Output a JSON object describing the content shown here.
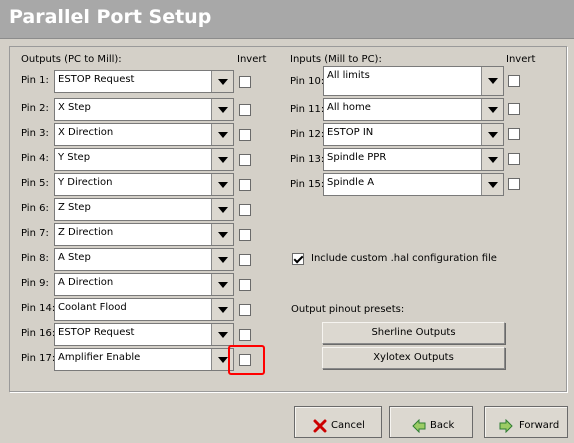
{
  "header": {
    "title": "Parallel Port Setup"
  },
  "outputs": {
    "heading": "Outputs (PC to Mill):",
    "invert_heading": "Invert",
    "rows": [
      {
        "pin": "Pin 1:",
        "value": "ESTOP Request",
        "invert": false
      },
      {
        "pin": "Pin 2:",
        "value": "X Step",
        "invert": false
      },
      {
        "pin": "Pin 3:",
        "value": "X Direction",
        "invert": false
      },
      {
        "pin": "Pin 4:",
        "value": "Y Step",
        "invert": false
      },
      {
        "pin": "Pin 5:",
        "value": "Y Direction",
        "invert": false
      },
      {
        "pin": "Pin 6:",
        "value": "Z Step",
        "invert": false
      },
      {
        "pin": "Pin 7:",
        "value": "Z Direction",
        "invert": false
      },
      {
        "pin": "Pin 8:",
        "value": "A Step",
        "invert": false
      },
      {
        "pin": "Pin 9:",
        "value": "A Direction",
        "invert": false
      },
      {
        "pin": "Pin 14:",
        "value": "Coolant Flood",
        "invert": false
      },
      {
        "pin": "Pin 16:",
        "value": "ESTOP Request",
        "invert": false
      },
      {
        "pin": "Pin 17:",
        "value": "Amplifier Enable",
        "invert": false
      }
    ]
  },
  "inputs": {
    "heading": "Inputs (Mill to PC):",
    "invert_heading": "Invert",
    "rows": [
      {
        "pin": "Pin 10:",
        "value": "All limits",
        "invert": false
      },
      {
        "pin": "Pin 11:",
        "value": "All home",
        "invert": false
      },
      {
        "pin": "Pin 12:",
        "value": "ESTOP IN",
        "invert": false
      },
      {
        "pin": "Pin 13:",
        "value": "Spindle PPR",
        "invert": false
      },
      {
        "pin": "Pin 15:",
        "value": "Spindle A",
        "invert": false
      }
    ]
  },
  "custom_hal": {
    "label": "Include custom .hal configuration file",
    "checked": true
  },
  "presets": {
    "heading": "Output pinout presets:",
    "buttons": [
      "Sherline Outputs",
      "Xylotex Outputs"
    ]
  },
  "footer": {
    "cancel": "Cancel",
    "back": "Back",
    "forward": "Forward"
  },
  "colors": {
    "header_bg": "#a8a8a8",
    "window_bg": "#d4d0c8",
    "highlight": "#ff0000",
    "cancel_icon": "#cc0000",
    "nav_icon": "#2e7d32"
  }
}
